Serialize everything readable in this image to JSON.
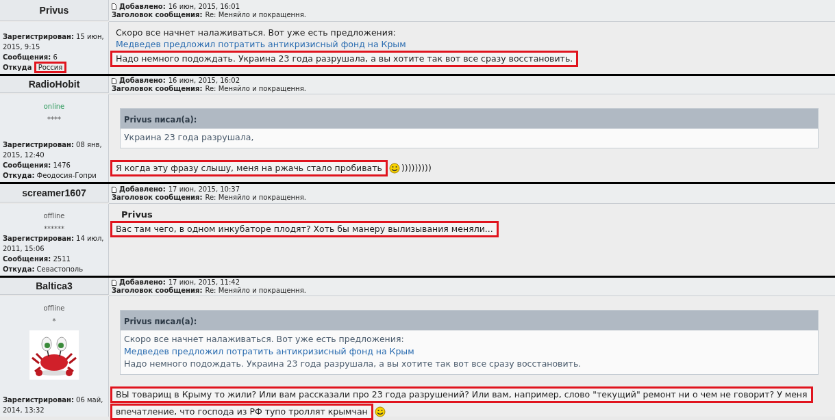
{
  "posts": [
    {
      "author": "Privus",
      "header": {
        "added_label": "Добавлено:",
        "added": "16 июн, 2015, 16:01",
        "subject_label": "Заголовок сообщения:",
        "subject": "Re: Меняйло и покращення."
      },
      "profile": {
        "fields": [
          {
            "label": "Зарегистрирован:",
            "value": "15 июн, 2015, 9:15",
            "highlighted": false
          },
          {
            "label": "Сообщения:",
            "value": "6",
            "highlighted": false
          },
          {
            "label": "Откуда",
            "value": "Россия",
            "highlighted": true
          }
        ]
      },
      "body": [
        {
          "kind": "text",
          "text": "Скоро все начнет налаживаться. Вот уже есть предложения:",
          "highlighted": false
        },
        {
          "kind": "link",
          "text": "Медведев предложил потратить антикризисный фонд на Крым"
        },
        {
          "kind": "text",
          "text": "Надо немного подождать. Украина 23 года разрушала, а вы хотите так вот все сразу восстановить.",
          "highlighted": true
        }
      ]
    },
    {
      "author": "RadioHobit",
      "header": {
        "added_label": "Добавлено:",
        "added": "16 июн, 2015, 16:02",
        "subject_label": "Заголовок сообщения:",
        "subject": "Re: Меняйло и покращення."
      },
      "profile": {
        "status": "online",
        "rank": "****",
        "fields": [
          {
            "label": "Зарегистрирован:",
            "value": "08 янв, 2015, 12:40",
            "highlighted": false
          },
          {
            "label": "Сообщения:",
            "value": "1476",
            "highlighted": false
          },
          {
            "label": "Откуда:",
            "value": "Феодосия-Гопри",
            "highlighted": false
          }
        ]
      },
      "body": [
        {
          "kind": "quote",
          "author": "Privus писал(а):",
          "lines": [
            {
              "kind": "text",
              "text": "Украина 23 года разрушала,"
            }
          ]
        },
        {
          "kind": "text",
          "text": "Я когда эту фразу слышу, меня на ржачь стало пробивать",
          "smiley": true,
          "suffix": ")))))))))",
          "highlighted": true
        }
      ]
    },
    {
      "author": "screamer1607",
      "header": {
        "added_label": "Добавлено:",
        "added": "17 июн, 2015, 10:37",
        "subject_label": "Заголовок сообщения:",
        "subject": "Re: Меняйло и покращення."
      },
      "profile": {
        "status": "offline",
        "rank": "******",
        "fields": [
          {
            "label": "Зарегистрирован:",
            "value": "14 июл, 2011, 15:06",
            "highlighted": false
          },
          {
            "label": "Сообщения:",
            "value": "2511",
            "highlighted": false
          },
          {
            "label": "Откуда:",
            "value": "Севастополь",
            "highlighted": false
          }
        ]
      },
      "body": [
        {
          "kind": "name",
          "text": "Privus"
        },
        {
          "kind": "text",
          "text": "Вас там чего, в одном инкубаторе плодят? Хоть бы манеру вылизывания меняли...",
          "highlighted": true
        }
      ]
    },
    {
      "author": "Baltica3",
      "header": {
        "added_label": "Добавлено:",
        "added": "17 июн, 2015, 11:42",
        "subject_label": "Заголовок сообщения:",
        "subject": "Re: Меняйло и покращення."
      },
      "profile": {
        "status": "offline",
        "rank": "*",
        "avatar": true,
        "fields": [
          {
            "label": "Зарегистрирован:",
            "value": "06 май, 2014, 13:32",
            "highlighted": false
          }
        ]
      },
      "body": [
        {
          "kind": "quote",
          "author": "Privus писал(а):",
          "lines": [
            {
              "kind": "text",
              "text": "Скоро все начнет налаживаться. Вот уже есть предложения:"
            },
            {
              "kind": "link",
              "text": "Медведев предложил потратить антикризисный фонд на Крым"
            },
            {
              "kind": "text",
              "text": "Надо немного подождать. Украина 23 года разрушала, а вы хотите так вот все сразу восстановить."
            }
          ]
        },
        {
          "kind": "text",
          "text": "ВЫ товарищ в Крыму то жили? Или вам рассказали про 23 года разрушений? Или вам, например, слово \"текущий\" ремонт ни о чем не говорит? У меня",
          "highlighted": true
        },
        {
          "kind": "text",
          "text": "впечатление, что господа из РФ тупо троллят крымчан",
          "smiley": true,
          "highlighted": true
        }
      ]
    }
  ]
}
